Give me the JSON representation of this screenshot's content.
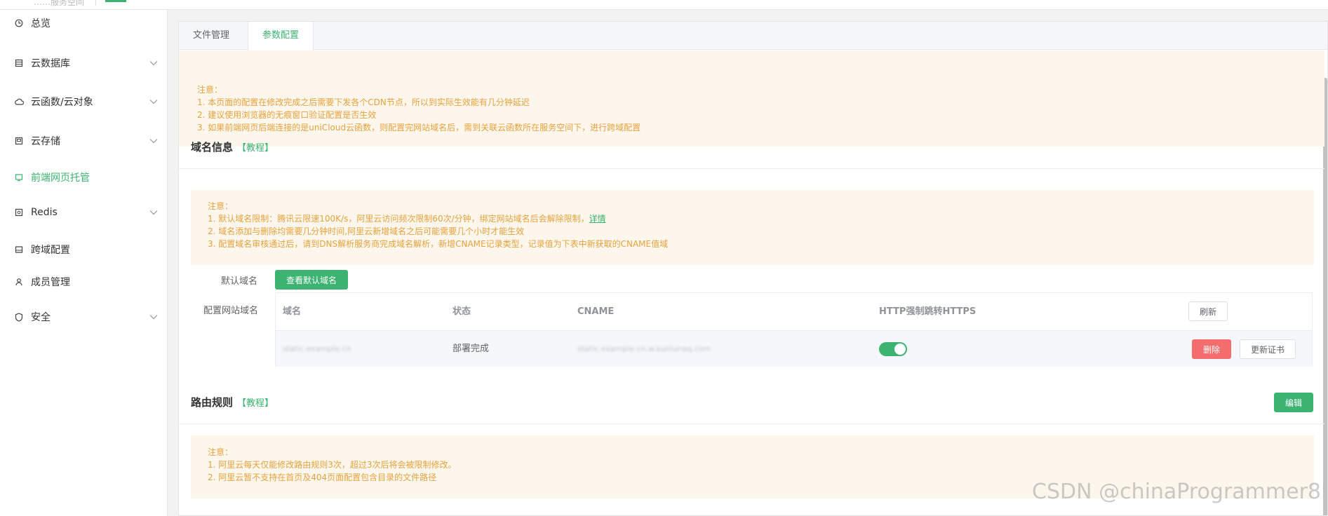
{
  "topbar": {
    "crumb": "……服务空间"
  },
  "sidebar": {
    "items": [
      {
        "label": "总览",
        "icon": "clock-icon",
        "expandable": false,
        "active": false
      },
      {
        "label": "云数据库",
        "icon": "database-icon",
        "expandable": true,
        "active": false
      },
      {
        "label": "云函数/云对象",
        "icon": "cloud-icon",
        "expandable": true,
        "active": false
      },
      {
        "label": "云存储",
        "icon": "storage-icon",
        "expandable": true,
        "active": false
      },
      {
        "label": "前端网页托管",
        "icon": "hosting-icon",
        "expandable": false,
        "active": true
      },
      {
        "label": "Redis",
        "icon": "redis-icon",
        "expandable": true,
        "active": false
      },
      {
        "label": "跨域配置",
        "icon": "cors-icon",
        "expandable": false,
        "active": false
      },
      {
        "label": "成员管理",
        "icon": "member-icon",
        "expandable": false,
        "active": false
      },
      {
        "label": "安全",
        "icon": "shield-icon",
        "expandable": true,
        "active": false
      }
    ]
  },
  "tabs": [
    {
      "label": "文件管理",
      "active": false
    },
    {
      "label": "参数配置",
      "active": true
    }
  ],
  "notice_top": {
    "title": "注意：",
    "lines": [
      "1. 本页面的配置在修改完成之后需要下发各个CDN节点，所以到实际生效能有几分钟延迟",
      "2. 建议使用浏览器的无痕窗口验证配置是否生效",
      "3. 如果前端网页后端连接的是uniCloud云函数，则配置完网站域名后，需到关联云函数所在服务空间下，进行跨域配置"
    ]
  },
  "domain_section": {
    "title": "域名信息",
    "tutorial_link": "【教程】",
    "notice": {
      "title": "注意：",
      "line1": "1. 默认域名限制：腾讯云限速100K/s，阿里云访问频次限制60次/分钟，绑定网站域名后会解除限制，",
      "line1_link": "详情",
      "line2": "2. 域名添加与删除均需要几分钟时间,阿里云新增域名之后可能需要几个小时才能生效",
      "line3": "3. 配置域名审核通过后，请到DNS解析服务商完成域名解析，新增CNAME记录类型，记录值为下表中新获取的CNAME值域"
    },
    "default_domain_label": "默认域名",
    "view_default_button": "查看默认域名",
    "site_domain_label": "配置网站域名",
    "table": {
      "headers": {
        "domain": "域名",
        "status": "状态",
        "cname": "CNAME",
        "https": "HTTP强制跳转HTTPS"
      },
      "refresh_button": "刷新",
      "rows": [
        {
          "domain": "static.example.cn",
          "status": "部署完成",
          "cname": "static.example.cn.w.kunlunaq.com",
          "https_enabled": true,
          "delete_button": "删除",
          "update_cert_button": "更新证书"
        }
      ]
    }
  },
  "route_section": {
    "title": "路由规则",
    "tutorial_link": "【教程】",
    "edit_button": "编辑",
    "notice": {
      "title": "注意：",
      "lines": [
        "1. 阿里云每天仅能修改路由规则3次，超过3次后将会被限制修改。",
        "2. 阿里云暂不支持在首页及404页面配置包含目录的文件路径"
      ]
    }
  },
  "watermark": "CSDN @chinaProgrammer8"
}
